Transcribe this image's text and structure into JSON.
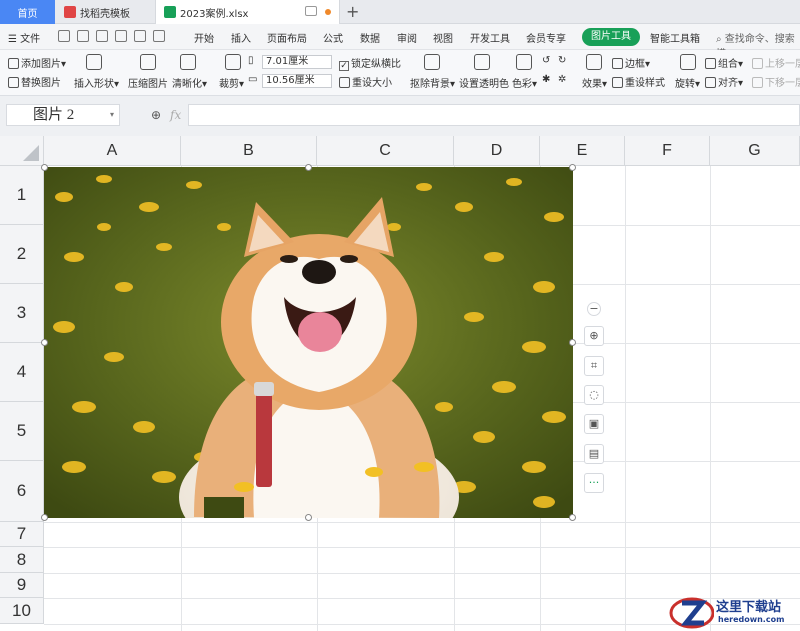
{
  "tabs": {
    "home": "首页",
    "template": "找稻壳模板",
    "file": "2023案例.xlsx"
  },
  "menu": {
    "file": "文件",
    "items": [
      "开始",
      "插入",
      "页面布局",
      "公式",
      "数据",
      "审阅",
      "视图",
      "开发工具",
      "会员专享"
    ],
    "active": "图片工具",
    "smart": "智能工具箱",
    "search": "查找命令、搜索模"
  },
  "tools": {
    "add_picture": "添加图片",
    "replace_picture": "替换图片",
    "insert_shape": "插入形状",
    "compress": "压缩图片",
    "sharpen": "清晰化",
    "crop": "裁剪",
    "height": "7.01厘米",
    "width": "10.56厘米",
    "lock_ratio": "锁定纵横比",
    "reset_size": "重设大小",
    "remove_bg": "抠除背景",
    "transparent": "设置透明色",
    "color": "色彩",
    "effects": "效果",
    "border": "边框",
    "reset_style": "重设样式",
    "rotate": "旋转",
    "group": "组合",
    "align": "对齐",
    "bring_up": "上移一层",
    "send_down": "下移一层"
  },
  "namebox": "图片 2",
  "fx": "fx",
  "columns": [
    "A",
    "B",
    "C",
    "D",
    "E",
    "F",
    "G"
  ],
  "rows": [
    "1",
    "2",
    "3",
    "4",
    "5",
    "6",
    "7",
    "8",
    "9",
    "10"
  ],
  "side_tools": [
    "zoom-icon",
    "crop-icon",
    "bulb-icon",
    "convert-icon",
    "image-icon",
    "more-icon"
  ],
  "side_more": "···",
  "watermark": {
    "title": "这里下载站",
    "url": "heredown.com"
  },
  "colors": {
    "accent_green": "#18a058",
    "tab_blue": "#4a87f4",
    "meadow": "#5a6b1e",
    "flower": "#f2c024"
  }
}
